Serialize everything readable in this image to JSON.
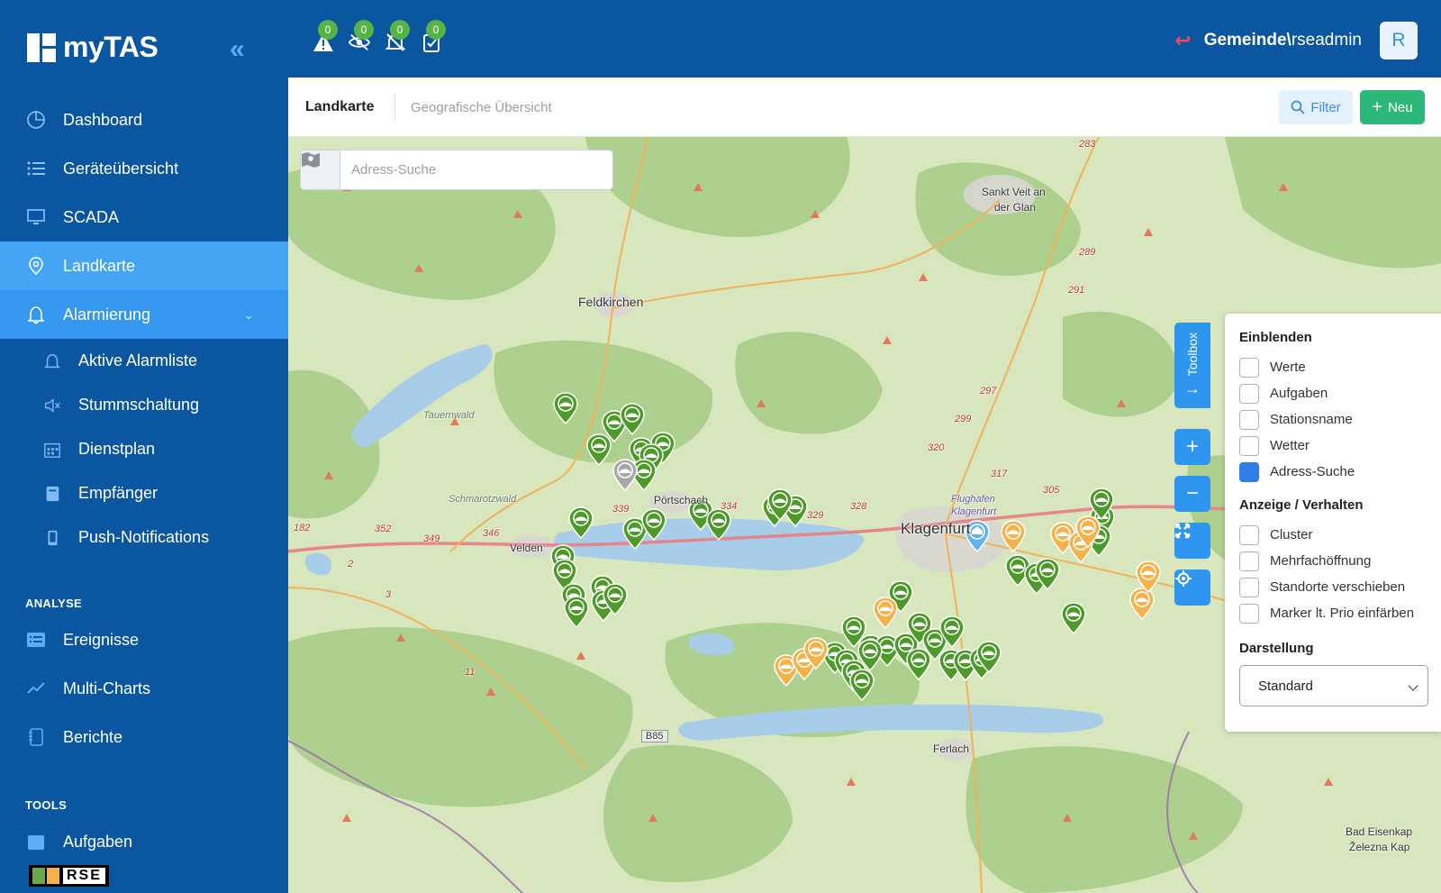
{
  "brand": {
    "name": "myTAS"
  },
  "sidebar": {
    "items": [
      {
        "label": "Dashboard",
        "icon": "dashboard-icon"
      },
      {
        "label": "Geräteübersicht",
        "icon": "list-icon"
      },
      {
        "label": "SCADA",
        "icon": "monitor-icon"
      },
      {
        "label": "Landkarte",
        "icon": "map-pin-icon",
        "active": true
      },
      {
        "label": "Alarmierung",
        "icon": "bell-icon",
        "expanded": true
      }
    ],
    "subitems": [
      {
        "label": "Aktive Alarmliste",
        "icon": "bell-icon"
      },
      {
        "label": "Stummschaltung",
        "icon": "mute-icon"
      },
      {
        "label": "Dienstplan",
        "icon": "calendar-icon"
      },
      {
        "label": "Empfänger",
        "icon": "contact-book-icon"
      },
      {
        "label": "Push-Notifications",
        "icon": "mobile-icon"
      }
    ],
    "analyse_title": "ANALYSE",
    "analyse": [
      {
        "label": "Ereignisse",
        "icon": "event-list-icon"
      },
      {
        "label": "Multi-Charts",
        "icon": "line-chart-icon"
      },
      {
        "label": "Berichte",
        "icon": "report-icon"
      }
    ],
    "tools_title": "TOOLS",
    "tools": [
      {
        "label": "Aufgaben",
        "icon": "calendar-icon"
      }
    ],
    "footer_logo": "RSE"
  },
  "header": {
    "badges": [
      {
        "icon": "warning-icon",
        "count": "0"
      },
      {
        "icon": "eye-off-icon",
        "count": "0"
      },
      {
        "icon": "bell-off-icon",
        "count": "0"
      },
      {
        "icon": "clipboard-check-icon",
        "count": "0"
      }
    ],
    "user_domain": "Gemeinde\\",
    "user_name": "rseadmin",
    "avatar": "R"
  },
  "page": {
    "title": "Landkarte",
    "subtitle": "Geografische Übersicht",
    "filter_label": "Filter",
    "new_label": "Neu"
  },
  "map": {
    "search_placeholder": "Adress-Suche",
    "toolbox_label": "Toolbox",
    "labels": {
      "feldkirchen": "Feldkirchen",
      "sankt_veit": "Sankt Veit an",
      "der_glan": "der Glan",
      "klagenfurt": "Klagenfurt",
      "poertschach": "Pörtschach",
      "velden": "Velden",
      "ferlach": "Ferlach",
      "tauernwald": "Tauernwald",
      "schmarotzwald": "Schmarotzwald",
      "flughafen": "Flughafen",
      "flughafen2": "Klagenfurt",
      "bad_eisen": "Bad Eisenkap",
      "zelezna": "Železna Kap",
      "b85": "B85",
      "r283": "283",
      "r289": "289",
      "r291": "291",
      "r297": "297",
      "r299": "299",
      "r320": "320",
      "r317": "317",
      "r305": "305",
      "r328": "328",
      "r329": "329",
      "r334": "334",
      "r339": "339",
      "r346": "346",
      "r349": "349",
      "r352": "352",
      "r182": "182",
      "r2": "2",
      "r3": "3",
      "r11": "11"
    }
  },
  "panel": {
    "section1": "Einblenden",
    "show": [
      {
        "label": "Werte",
        "checked": false
      },
      {
        "label": "Aufgaben",
        "checked": false
      },
      {
        "label": "Stationsname",
        "checked": false
      },
      {
        "label": "Wetter",
        "checked": false
      },
      {
        "label": "Adress-Suche",
        "checked": true
      }
    ],
    "section2": "Anzeige / Verhalten",
    "behavior": [
      {
        "label": "Cluster",
        "checked": false
      },
      {
        "label": "Mehrfachöffnung",
        "checked": false
      },
      {
        "label": "Standorte verschieben",
        "checked": false
      },
      {
        "label": "Marker lt. Prio einfärben",
        "checked": false
      }
    ],
    "section3": "Darstellung",
    "display_value": "Standard"
  },
  "colors": {
    "sidebar": "#0b56a0",
    "active": "#44a5f5",
    "marker_green": "#4d9a2a",
    "marker_orange": "#f6b24a",
    "accent_blue": "#2f96f0",
    "new_green": "#2db87a"
  }
}
